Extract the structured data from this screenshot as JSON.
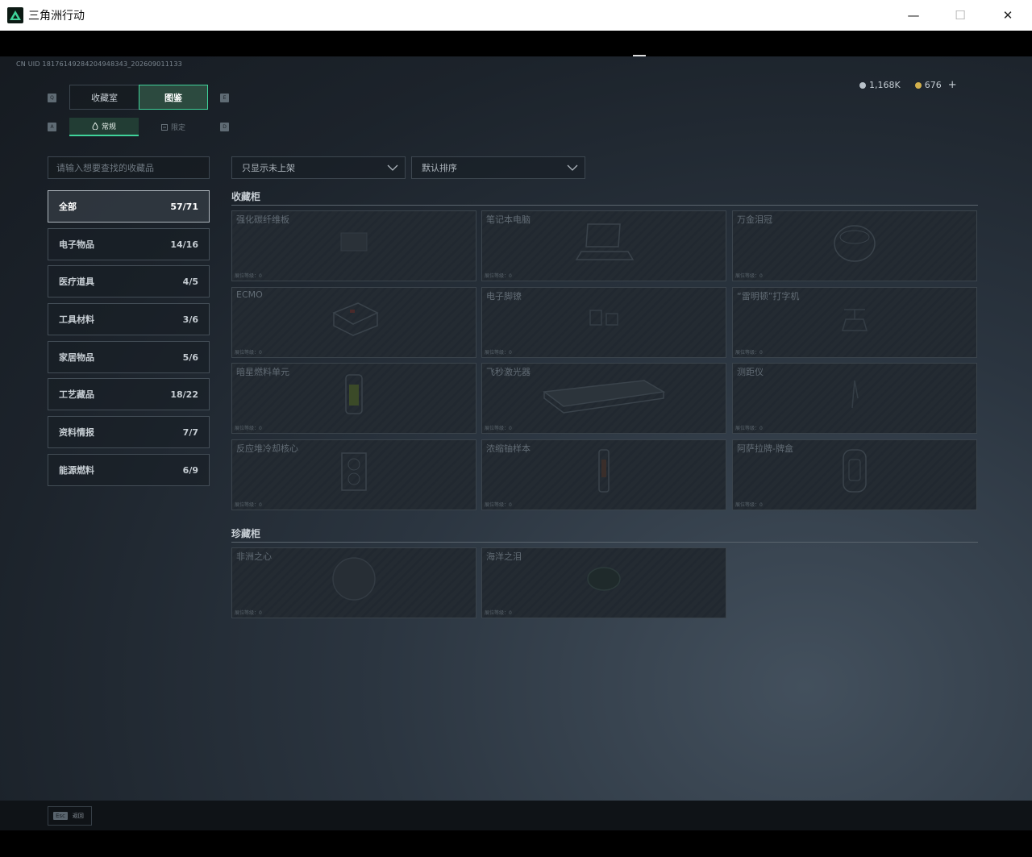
{
  "window": {
    "title": "三角洲行动",
    "minimize_glyph": "—",
    "maximize_glyph": "☐",
    "close_glyph": "✕"
  },
  "uid_text": "CN UID 18176149284204948343_202609011133",
  "currency": {
    "silver": "1,168K",
    "gold": "676",
    "add_glyph": "+"
  },
  "top_tabs": {
    "left_key": "Q",
    "right_key": "E",
    "items": [
      {
        "label": "收藏室"
      },
      {
        "label": "图鉴"
      }
    ]
  },
  "sub_tabs": {
    "left_key": "A",
    "right_key": "D",
    "items": [
      {
        "label": "常规"
      },
      {
        "label": "限定"
      }
    ]
  },
  "search": {
    "placeholder": "请输入想要查找的收藏品"
  },
  "categories": [
    {
      "label": "全部",
      "count": "57/71"
    },
    {
      "label": "电子物品",
      "count": "14/16"
    },
    {
      "label": "医疗道具",
      "count": "4/5"
    },
    {
      "label": "工具材料",
      "count": "3/6"
    },
    {
      "label": "家居物品",
      "count": "5/6"
    },
    {
      "label": "工艺藏品",
      "count": "18/22"
    },
    {
      "label": "资料情报",
      "count": "7/7"
    },
    {
      "label": "能源燃料",
      "count": "6/9"
    }
  ],
  "filters": {
    "show_filter": "只显示未上架",
    "sort": "默认排序"
  },
  "sections": [
    {
      "title": "收藏柜",
      "items": [
        {
          "name": "强化碳纤维板",
          "footer": "展位等级：0"
        },
        {
          "name": "笔记本电脑",
          "footer": "展位等级：0"
        },
        {
          "name": "万金泪冠",
          "footer": "展位等级：0"
        },
        {
          "name": "ECMO",
          "footer": "展位等级：0"
        },
        {
          "name": "电子脚镣",
          "footer": "展位等级：0"
        },
        {
          "name": "“雷明顿”打字机",
          "footer": "展位等级：0"
        },
        {
          "name": "暗星燃料单元",
          "footer": "展位等级：0"
        },
        {
          "name": "飞秒激光器",
          "footer": "展位等级：0"
        },
        {
          "name": "测距仪",
          "footer": "展位等级：0"
        },
        {
          "name": "反应堆冷却核心",
          "footer": "展位等级：0"
        },
        {
          "name": "浓缩铀样本",
          "footer": "展位等级：0"
        },
        {
          "name": "阿萨拉牌-牌盒",
          "footer": "展位等级：0"
        }
      ]
    },
    {
      "title": "珍藏柜",
      "items": [
        {
          "name": "非洲之心",
          "footer": "展位等级：0"
        },
        {
          "name": "海洋之泪",
          "footer": "展位等级：0"
        }
      ]
    }
  ],
  "bottom": {
    "esc_key": "Esc",
    "esc_label": "返回"
  },
  "colors": {
    "accent": "#3fd39a",
    "gold": "#d2b04c",
    "silver": "#b9c2ca"
  }
}
